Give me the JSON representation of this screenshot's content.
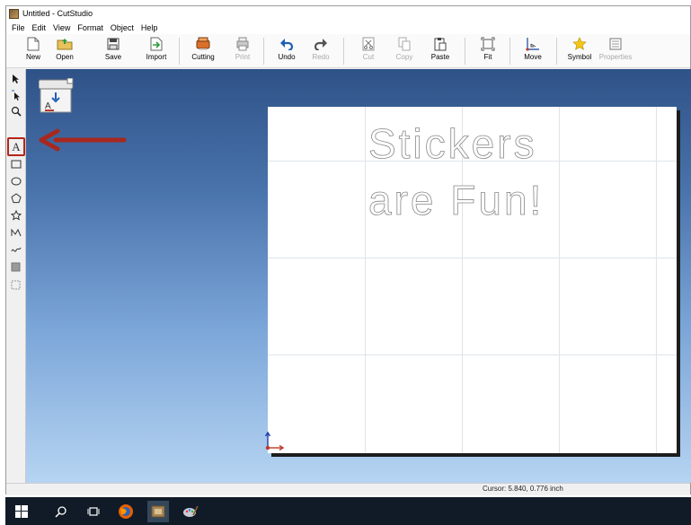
{
  "window": {
    "title": "Untitled - CutStudio"
  },
  "menu": [
    "File",
    "Edit",
    "View",
    "Format",
    "Object",
    "Help"
  ],
  "toolbar": {
    "new": "New",
    "open": "Open",
    "save": "Save",
    "import": "Import",
    "cutting": "Cutting",
    "print": "Print",
    "undo": "Undo",
    "redo": "Redo",
    "cut": "Cut",
    "copy": "Copy",
    "paste": "Paste",
    "fit": "Fit",
    "move": "Move",
    "symbol": "Symbol",
    "properties": "Properties"
  },
  "tools": {
    "text_tool_label": "A",
    "items": [
      "select-arrow-icon",
      "edit-points-icon",
      "zoom-icon",
      "text-tool-icon",
      "rectangle-icon",
      "ellipse-icon",
      "polygon-icon",
      "star-icon",
      "polyline-icon",
      "freehand-icon",
      "fill-icon",
      "cutout-icon"
    ]
  },
  "sheet": {
    "line1": "Stickers",
    "line2": "are Fun!"
  },
  "status": {
    "cursor": "Cursor: 5.840, 0.776 inch"
  },
  "colors": {
    "accent": "#b5251b",
    "canvas_top": "#2e5288",
    "canvas_bottom": "#b6d4f2"
  }
}
